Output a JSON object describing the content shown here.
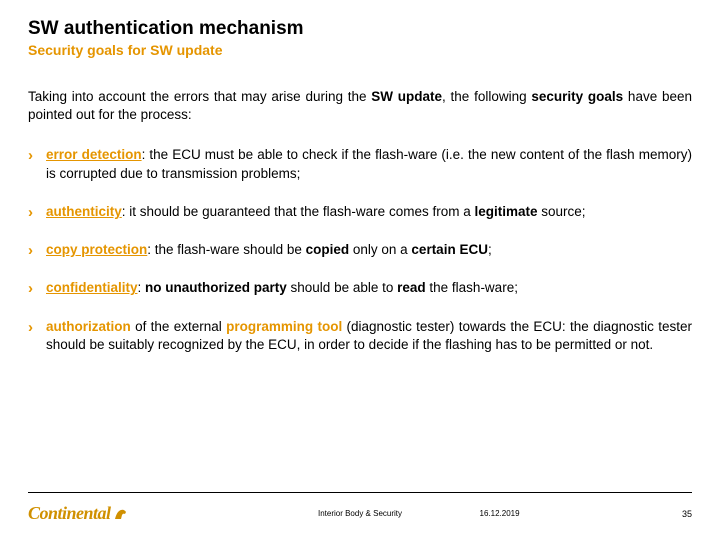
{
  "header": {
    "title": "SW authentication mechanism",
    "subtitle": "Security goals for SW update"
  },
  "intro": {
    "pre": "Taking into account the errors that may arise during the ",
    "bold1": "SW update",
    "mid": ", the following ",
    "bold2": "security goals",
    "post": " have been pointed out for the process:"
  },
  "bullets": [
    {
      "kw": "error detection",
      "rest": ": the ECU must be able to check if the flash-ware (i.e. the new content of the flash memory)  is corrupted due to transmission problems;"
    },
    {
      "kw": "authenticity",
      "rest_pre": ":  it should be guaranteed that the flash-ware comes from a ",
      "bold": "legitimate",
      "rest_post": " source;"
    },
    {
      "kw": "copy protection",
      "rest_pre": ": the flash-ware should be ",
      "bold1": "copied",
      "mid": " only on a ",
      "bold2": "certain ECU",
      "rest_post": ";"
    },
    {
      "kw": "confidentiality",
      "rest_pre": ": ",
      "bold1": "no unauthorized party",
      "mid": " should be able to ",
      "bold2": "read",
      "rest_post": " the flash-ware;"
    },
    {
      "kw": "authorization",
      "rest_pre": " of the external ",
      "kwnu": "programming tool",
      "rest_post": " (diagnostic tester) towards the ECU: the diagnostic tester should be suitably recognized by the ECU, in order to decide if the flashing has to be permitted or not."
    }
  ],
  "footer": {
    "logo_text": "Continental",
    "center": "Interior Body & Security",
    "date": "16.12.2019",
    "page": "35"
  }
}
